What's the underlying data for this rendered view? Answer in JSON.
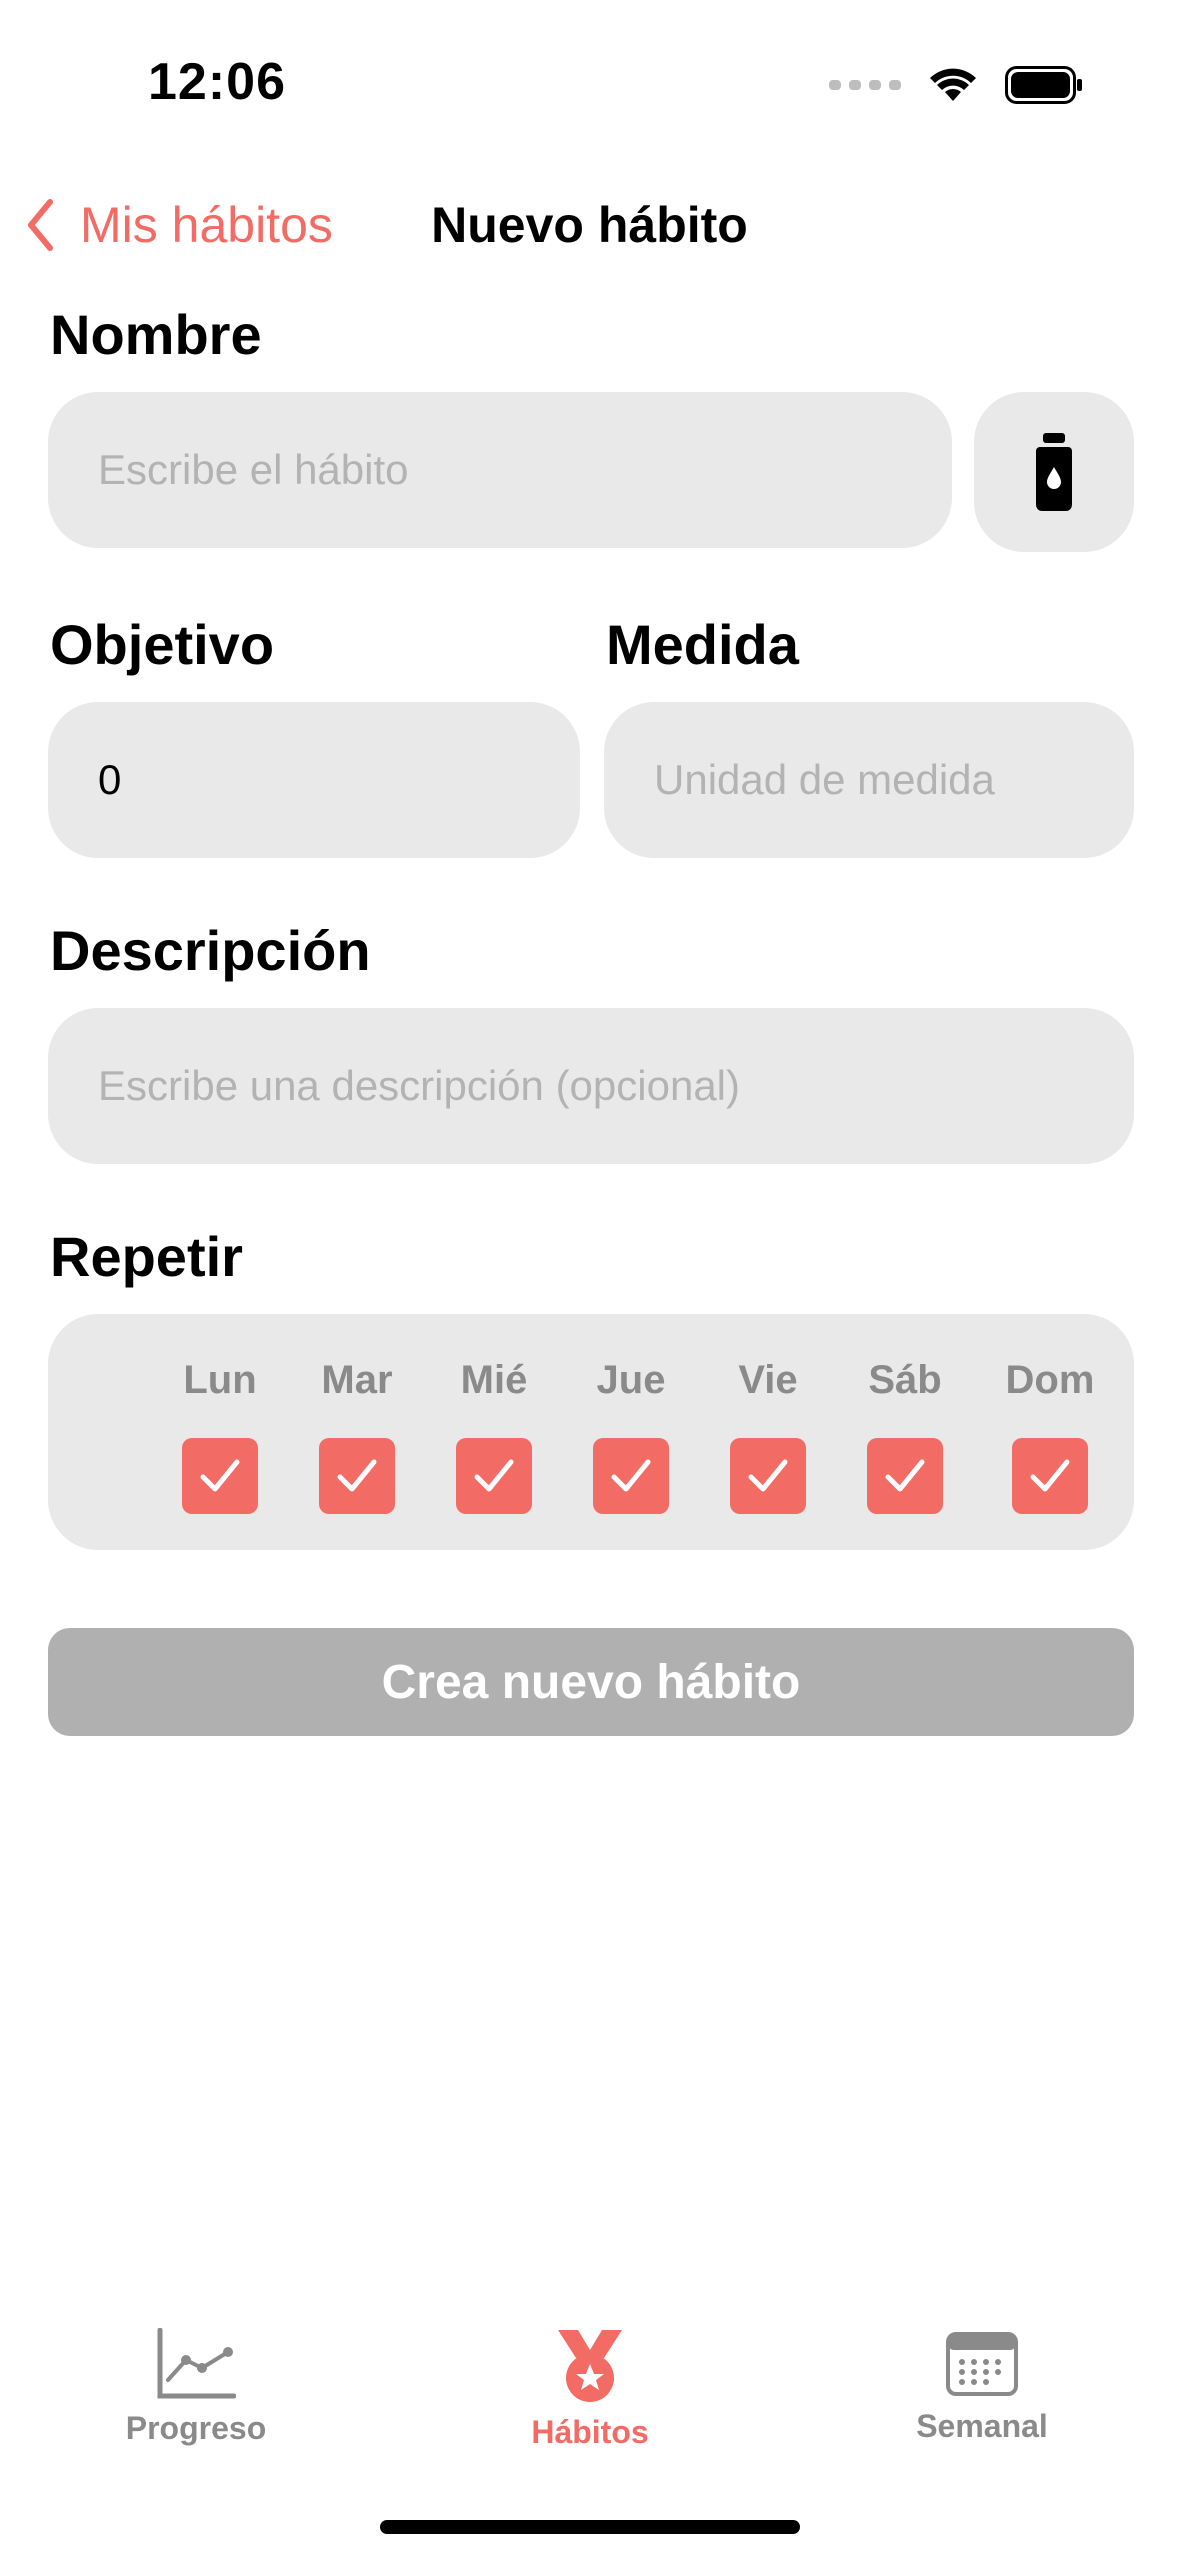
{
  "status_bar": {
    "time": "12:06"
  },
  "nav": {
    "back_label": "Mis hábitos",
    "title": "Nuevo hábito"
  },
  "form": {
    "name": {
      "label": "Nombre",
      "placeholder": "Escribe el hábito",
      "value": ""
    },
    "icon_button": {
      "icon": "bottle-icon"
    },
    "goal": {
      "label": "Objetivo",
      "value": "0"
    },
    "unit": {
      "label": "Medida",
      "placeholder": "Unidad de medida",
      "value": ""
    },
    "description": {
      "label": "Descripción",
      "placeholder": "Escribe una descripción (opcional)",
      "value": ""
    },
    "repeat": {
      "label": "Repetir",
      "days": [
        {
          "label": "Lun",
          "checked": true
        },
        {
          "label": "Mar",
          "checked": true
        },
        {
          "label": "Mié",
          "checked": true
        },
        {
          "label": "Jue",
          "checked": true
        },
        {
          "label": "Vie",
          "checked": true
        },
        {
          "label": "Sáb",
          "checked": true
        },
        {
          "label": "Dom",
          "checked": true
        }
      ]
    },
    "submit_label": "Crea nuevo hábito"
  },
  "tabs": [
    {
      "label": "Progreso",
      "icon": "chart-line-icon",
      "active": false
    },
    {
      "label": "Hábitos",
      "icon": "medal-icon",
      "active": true
    },
    {
      "label": "Semanal",
      "icon": "calendar-icon",
      "active": false
    }
  ],
  "colors": {
    "accent": "#f26b64",
    "field_bg": "#e9e9e9",
    "inactive_tab": "#8a8a8a",
    "disabled_button": "#b0b0b0"
  }
}
